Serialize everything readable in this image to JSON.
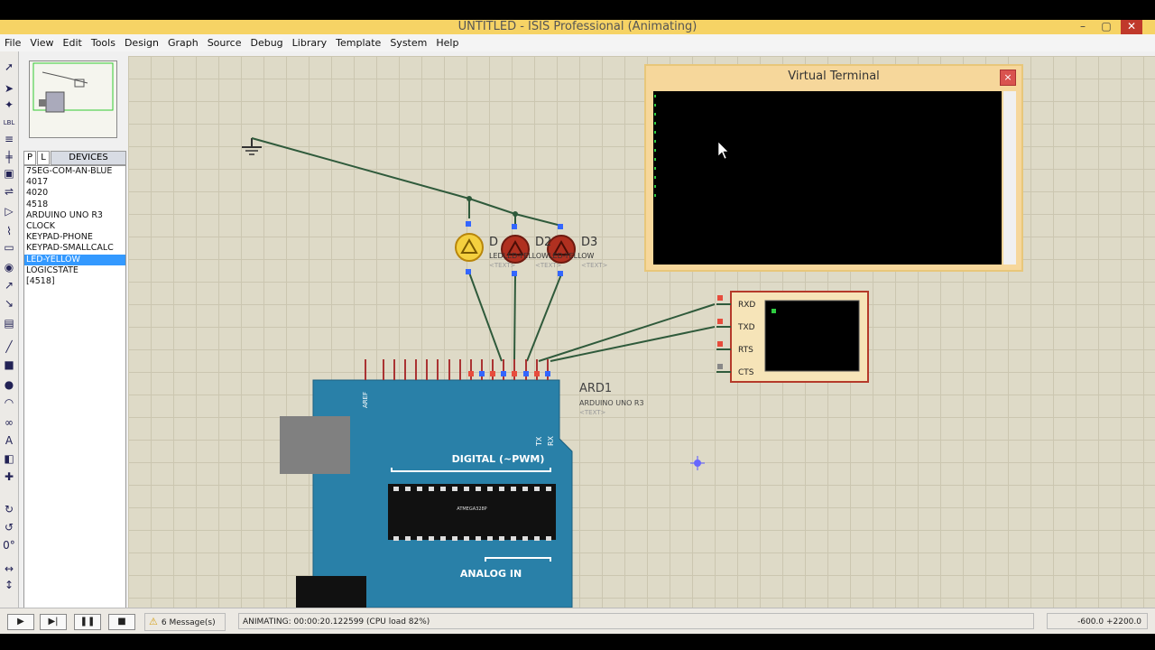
{
  "window": {
    "title": "UNTITLED - ISIS Professional (Animating)"
  },
  "menu": [
    "File",
    "View",
    "Edit",
    "Tools",
    "Design",
    "Graph",
    "Source",
    "Debug",
    "Library",
    "Template",
    "System",
    "Help"
  ],
  "tools": [
    {
      "icon": "selection-arrow-icon",
      "glyph": "➚"
    },
    {
      "icon": "component-icon",
      "glyph": "➤"
    },
    {
      "icon": "junction-dot-icon",
      "glyph": "✦"
    },
    {
      "icon": "wire-label-icon",
      "glyph": "LBL"
    },
    {
      "icon": "text-script-icon",
      "glyph": "≡"
    },
    {
      "icon": "bus-icon",
      "glyph": "╪"
    },
    {
      "icon": "subcircuit-icon",
      "glyph": "▣"
    },
    {
      "icon": "terminal-icon",
      "glyph": "⇌"
    },
    {
      "icon": "device-pin-icon",
      "glyph": "▷"
    },
    {
      "icon": "graph-icon",
      "glyph": "⌇"
    },
    {
      "icon": "tape-recorder-icon",
      "glyph": "▭"
    },
    {
      "icon": "generator-icon",
      "glyph": "◉"
    },
    {
      "icon": "voltage-probe-icon",
      "glyph": "↗"
    },
    {
      "icon": "current-probe-icon",
      "glyph": "↘"
    },
    {
      "icon": "virtual-instrument-icon",
      "glyph": "▤"
    },
    {
      "icon": "line-icon",
      "glyph": "╱"
    },
    {
      "icon": "box-icon",
      "glyph": "■"
    },
    {
      "icon": "circle-icon",
      "glyph": "●"
    },
    {
      "icon": "arc-icon",
      "glyph": "◠"
    },
    {
      "icon": "path-icon",
      "glyph": "∞"
    },
    {
      "icon": "text-icon",
      "glyph": "A"
    },
    {
      "icon": "symbol-icon",
      "glyph": "◧"
    },
    {
      "icon": "marker-icon",
      "glyph": "✚"
    },
    {
      "icon": "rotate-cw-icon",
      "glyph": "↻"
    },
    {
      "icon": "rotate-ccw-icon",
      "glyph": "↺"
    },
    {
      "icon": "angle-field-icon",
      "glyph": "0°"
    },
    {
      "icon": "flip-horizontal-icon",
      "glyph": "↔"
    },
    {
      "icon": "flip-vertical-icon",
      "glyph": "↕"
    }
  ],
  "devices": {
    "tab_p": "P",
    "tab_l": "L",
    "header": "DEVICES",
    "items": [
      "7SEG-COM-AN-BLUE",
      "4017",
      "4020",
      "4518",
      "ARDUINO UNO R3",
      "CLOCK",
      "KEYPAD-PHONE",
      "KEYPAD-SMALLCALC",
      "LED-YELLOW",
      "LOGICSTATE",
      "[4518]"
    ],
    "selected_index": 8
  },
  "virtual_terminal": {
    "title": "Virtual Terminal",
    "close": "×"
  },
  "schematic": {
    "leds": [
      {
        "ref": "D1",
        "ref_text": "D",
        "model": "LED-YELLOW",
        "text": "<TEXT>",
        "color": "#f4d03f"
      },
      {
        "ref": "D2",
        "ref_text": "D2",
        "model": "LED-YELLOW",
        "text": "<TEXT>",
        "color": "#c0392b"
      },
      {
        "ref": "D3",
        "ref_text": "D3",
        "model": "LED-YELLOW",
        "text": "<TEXT>",
        "color": "#c0392b"
      }
    ],
    "model_label": "LEDLED-YELLOWLED-YELLOW",
    "text_label": "<TEXT>",
    "arduino": {
      "ref": "ARD1",
      "model": "ARDUINO UNO R3",
      "text": "<TEXT>",
      "digital_label": "DIGITAL (~PWM)",
      "analog_label": "ANALOG IN",
      "chip_label": "ATMEGA328P",
      "aref": "AREF",
      "tx": "TX",
      "rx": "RX"
    },
    "terminal_pins": [
      "RXD",
      "TXD",
      "RTS",
      "CTS"
    ]
  },
  "status": {
    "messages": "6 Message(s)",
    "animating": "ANIMATING: 00:00:20.122599 (CPU load 82%)",
    "coords": "-600.0   +2200.0",
    "play": "▶",
    "step": "▶|",
    "pause": "❚❚",
    "stop": "■"
  },
  "colors": {
    "grid": "#dedac7",
    "arduino": "#2980a8",
    "wire": "#2f5a3b",
    "terminal_body": "#f6d79b"
  }
}
